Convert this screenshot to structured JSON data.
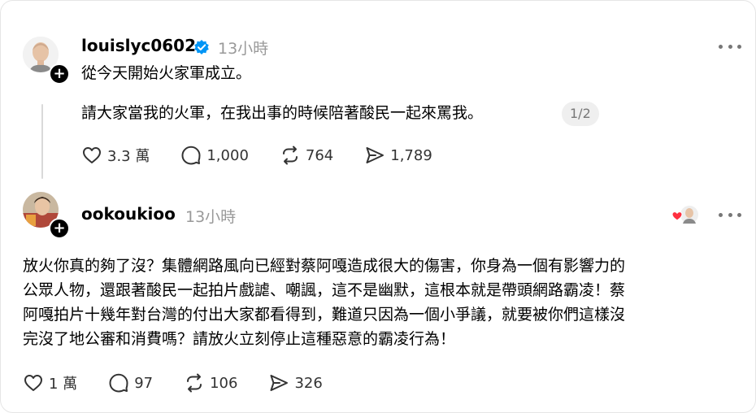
{
  "post1": {
    "username": "louislyc0602",
    "timestamp": "13小時",
    "lines": [
      "從今天開始火家軍成立。"
    ],
    "thread_text": "請大家當我的火軍，在我出事的時候陪著酸民一起來罵我。",
    "page_indicator": "1/2",
    "likes": "3.3 萬",
    "comments": "1,000",
    "reposts": "764",
    "shares": "1,789"
  },
  "post2": {
    "username": "ookoukioo",
    "timestamp": "13小時",
    "lines": [
      "放火你真的夠了沒？集體網路風向已經對蔡阿嘎造成很大的傷害，你身為一個有影響力的",
      "公眾人物，還跟著酸民一起拍片戲謔、嘲諷，這不是幽默，這根本就是帶頭網路霸凌！蔡",
      "阿嘎拍片十幾年對台灣的付出大家都看得到，難道只因為一個小爭議，就要被你們這樣沒",
      "完沒了地公審和消費嗎？請放火立刻停止這種惡意的霸凌行為！"
    ],
    "likes": "1 萬",
    "comments": "97",
    "reposts": "106",
    "shares": "326"
  },
  "icons": {
    "verified": "verified-badge-icon",
    "more": "more-options-icon",
    "like": "heart-icon",
    "comment": "comment-bubble-icon",
    "repost": "repost-icon",
    "share": "share-arrow-icon"
  },
  "colors": {
    "verified_blue": "#0095f6",
    "liked_red": "#ff3040",
    "secondary_text": "#999999"
  }
}
